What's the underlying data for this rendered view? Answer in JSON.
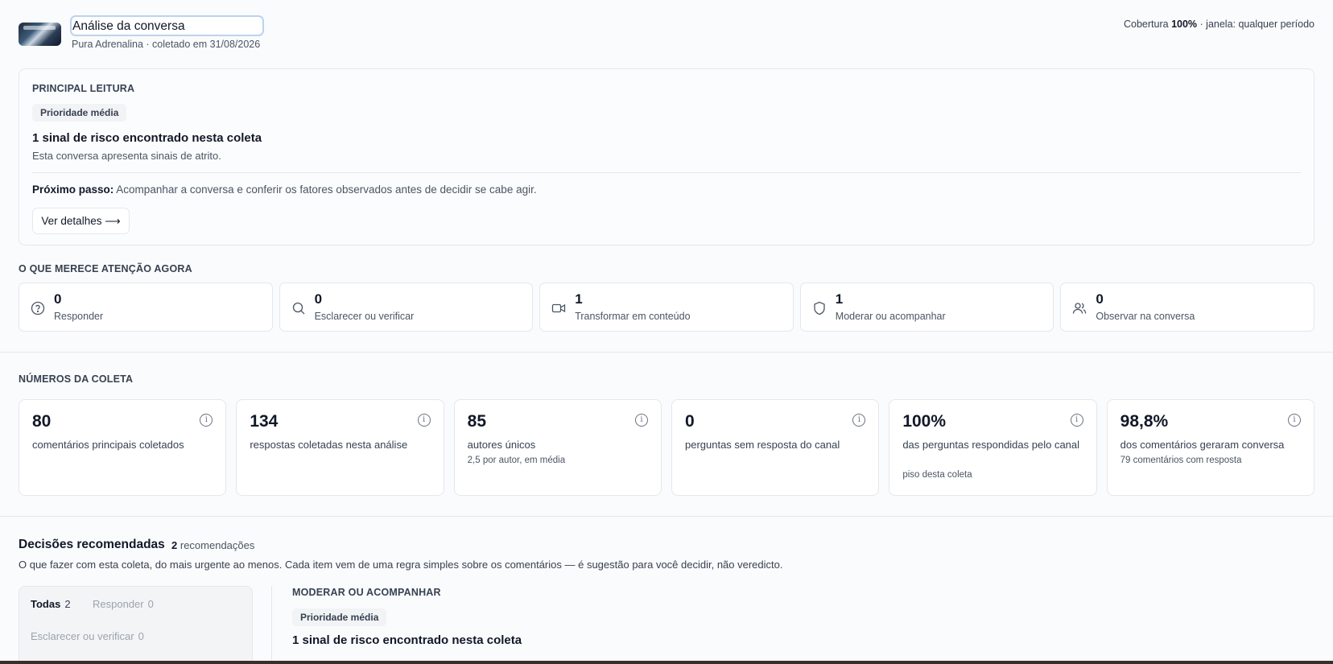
{
  "header": {
    "title_value": "Análise da conversa",
    "subtitle": "Pura Adrenalina · coletado em 31/08/2026",
    "coverage_prefix": "Cobertura",
    "coverage_value": "100%",
    "coverage_suffix": "· janela: qualquer período"
  },
  "principal": {
    "section_label": "PRINCIPAL LEITURA",
    "priority_badge": "Prioridade média",
    "headline": "1 sinal de risco encontrado nesta coleta",
    "description": "Esta conversa apresenta sinais de atrito.",
    "next_step_label": "Próximo passo:",
    "next_step_text": "Acompanhar a conversa e conferir os fatores observados antes de decidir se cabe agir.",
    "details_button": "Ver detalhes ⟶"
  },
  "attention": {
    "section_label": "O QUE MERECE ATENÇÃO AGORA",
    "cards": [
      {
        "icon": "question-circle-icon",
        "value": "0",
        "label": "Responder"
      },
      {
        "icon": "search-icon",
        "value": "0",
        "label": "Esclarecer ou verificar"
      },
      {
        "icon": "video-camera-icon",
        "value": "1",
        "label": "Transformar em conteúdo"
      },
      {
        "icon": "shield-icon",
        "value": "1",
        "label": "Moderar ou acompanhar"
      },
      {
        "icon": "users-icon",
        "value": "0",
        "label": "Observar na conversa"
      }
    ]
  },
  "numbers": {
    "section_label": "NÚMEROS DA COLETA",
    "cards": [
      {
        "value": "80",
        "label": "comentários principais coletados",
        "sub": ""
      },
      {
        "value": "134",
        "label": "respostas coletadas nesta análise",
        "sub": ""
      },
      {
        "value": "85",
        "label": "autores únicos",
        "sub": "2,5 por autor, em média"
      },
      {
        "value": "0",
        "label": "perguntas sem resposta do canal",
        "sub": ""
      },
      {
        "value": "100%",
        "label": "das perguntas respondidas pelo canal",
        "sub": "piso desta coleta"
      },
      {
        "value": "98,8%",
        "label": "dos comentários geraram conversa",
        "sub": "79 comentários com resposta"
      }
    ]
  },
  "decisions": {
    "title": "Decisões recomendadas",
    "count_value": "2",
    "count_label": "recomendações",
    "description": "O que fazer com esta coleta, do mais urgente ao menos. Cada item vem de uma regra simples sobre os comentários — é sugestão para você decidir, não veredicto.",
    "filters": [
      {
        "label": "Todas",
        "count": "2"
      },
      {
        "label": "Responder",
        "count": "0"
      },
      {
        "label": "Esclarecer ou verificar",
        "count": "0"
      }
    ],
    "detail": {
      "section_label": "MODERAR OU ACOMPANHAR",
      "priority_badge": "Prioridade média",
      "headline": "1 sinal de risco encontrado nesta coleta"
    }
  }
}
